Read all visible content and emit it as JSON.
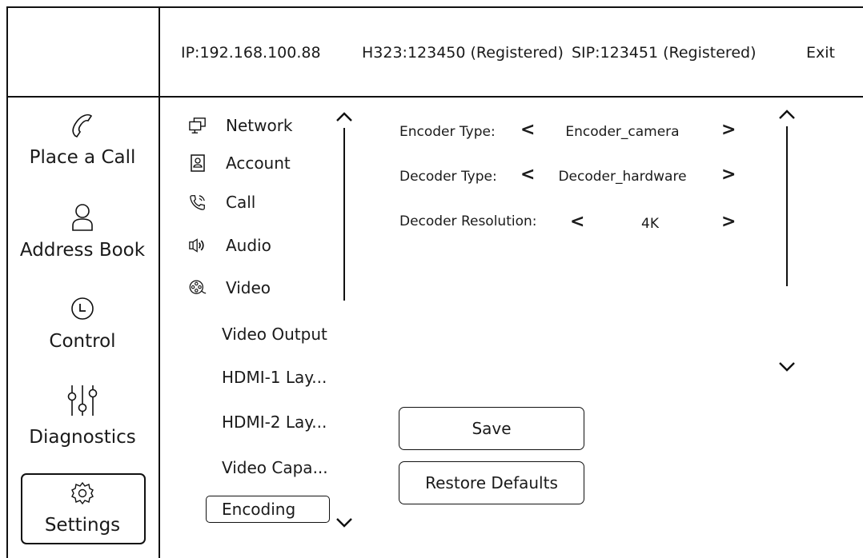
{
  "header": {
    "ip": "IP:192.168.100.88",
    "h323": "H323:123450 (Registered)",
    "sip": "SIP:123451 (Registered)",
    "exit": "Exit"
  },
  "nav": {
    "place_call": "Place a Call",
    "address_book": "Address Book",
    "control": "Control",
    "diagnostics": "Diagnostics",
    "settings": "Settings"
  },
  "menu": {
    "network": "Network",
    "account": "Account",
    "call": "Call",
    "audio": "Audio",
    "video": "Video",
    "video_output": "Video Output",
    "hdmi1": "HDMI-1 Lay...",
    "hdmi2": "HDMI-2 Lay...",
    "video_capa": "Video Capa...",
    "encoding": "Encoding"
  },
  "fields": {
    "encoder_label": "Encoder Type:",
    "encoder_value": "Encoder_camera",
    "decoder_label": "Decoder Type:",
    "decoder_value": "Decoder_hardware",
    "resolution_label": "Decoder Resolution:",
    "resolution_value": "4K",
    "prev": "<",
    "next": ">"
  },
  "buttons": {
    "save": "Save",
    "restore": "Restore Defaults"
  }
}
